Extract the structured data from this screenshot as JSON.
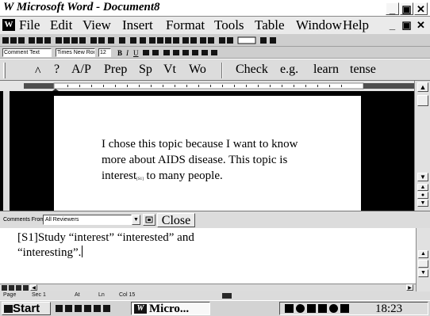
{
  "window": {
    "title": "Microsoft Word - Document8",
    "logo": "W",
    "controls": [
      "_",
      "×"
    ]
  },
  "menu": {
    "items": [
      "File",
      "Edit",
      "View",
      "Insert",
      "Format",
      "Tools",
      "Table",
      "Window",
      "Help"
    ]
  },
  "formatting": {
    "style": "Comment Text",
    "font": "Times New Roman",
    "size": "12"
  },
  "custom_toolbar": {
    "buttons": [
      "^",
      "?",
      "A/P",
      "Prep",
      "Sp",
      "Vt",
      "Wo",
      "Check",
      "e.g.",
      "learn",
      "tense"
    ]
  },
  "document": {
    "lines": [
      "I chose this topic because I want to know",
      "more about AIDS disease. This topic is",
      "interest",
      "to many people."
    ],
    "comment_marker": "[S1]"
  },
  "comments_pane": {
    "from_label": "Comments From:",
    "from_value": "All Reviewers",
    "close_label": "Close",
    "comment_lines": [
      "[S1]Study “interest” “interested” and",
      "“interesting”."
    ]
  },
  "status": {
    "page": "Page",
    "sec": "Sec 1",
    "at": "At",
    "ln": "Ln",
    "col": "Col 15"
  },
  "taskbar": {
    "start_label": "Start",
    "task_label": "Micro...",
    "clock": "18:23"
  }
}
